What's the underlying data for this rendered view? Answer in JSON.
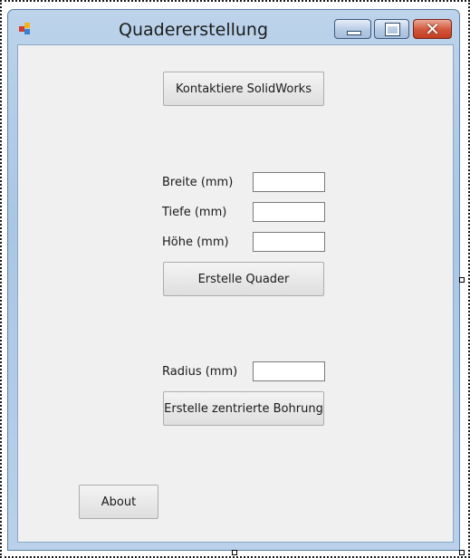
{
  "window": {
    "title": "Quadererstellung",
    "close_glyph": "✕"
  },
  "buttons": {
    "contact": "Kontaktiere SolidWorks",
    "create_box": "Erstelle Quader",
    "create_hole": "Erstelle zentrierte Bohrung",
    "about": "About"
  },
  "labels": {
    "width": "Breite (mm)",
    "depth": "Tiefe (mm)",
    "height": "Höhe (mm)",
    "radius": "Radius (mm)"
  },
  "inputs": {
    "width_value": "",
    "depth_value": "",
    "height_value": "",
    "radius_value": ""
  },
  "icons": {
    "app": "form-app-icon",
    "minimize": "minimize-icon",
    "maximize": "maximize-icon",
    "close": "close-icon"
  },
  "colors": {
    "frame": "#a9c6e4",
    "client": "#f0f0f0",
    "close_button": "#c13c22"
  }
}
